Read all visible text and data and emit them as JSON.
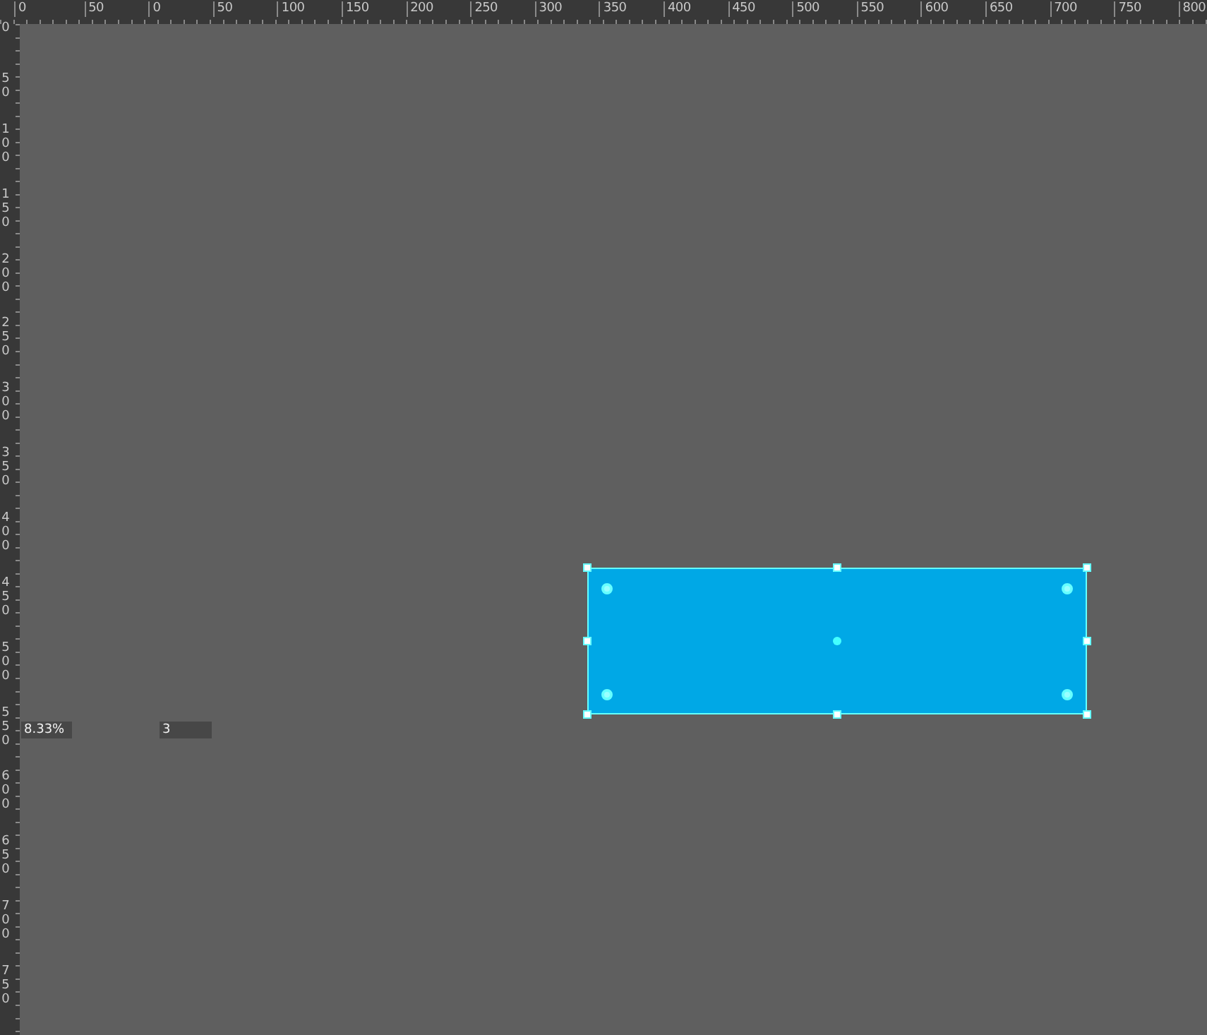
{
  "top_ruler": {
    "labels": [
      "0",
      "50",
      "0",
      "50",
      "100",
      "150",
      "200",
      "250",
      "300",
      "350",
      "400",
      "450",
      "500",
      "550",
      "600",
      "650",
      "700",
      "750",
      "800"
    ]
  },
  "left_ruler": {
    "labels": [
      "0",
      "50",
      "100",
      "150",
      "200",
      "250",
      "300",
      "350",
      "400",
      "450",
      "500",
      "550",
      "600",
      "650",
      "700",
      "750"
    ]
  },
  "canvas": {
    "shapes": [
      {
        "kind": "rectangle",
        "selected": true,
        "color": "#00a8e6"
      }
    ]
  },
  "fields": [
    {
      "value": "8.33%"
    },
    {
      "value": "3"
    }
  ]
}
